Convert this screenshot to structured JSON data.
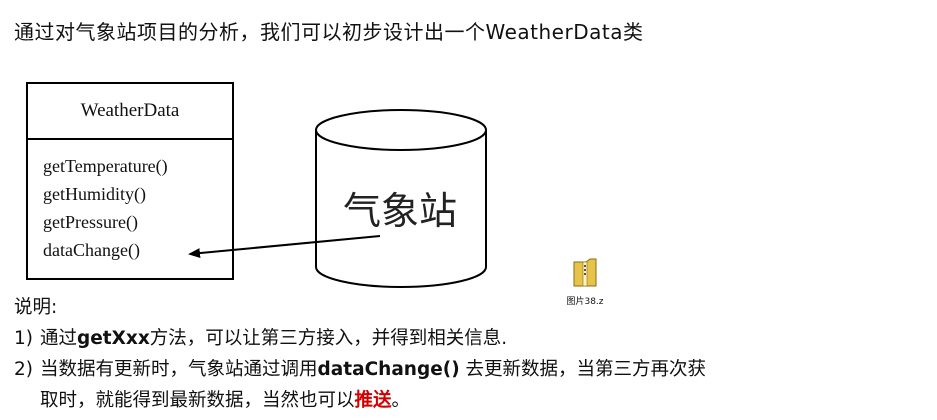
{
  "heading": "通过对气象站项目的分析，我们可以初步设计出一个WeatherData类",
  "uml": {
    "class_name": "WeatherData",
    "methods": [
      "getTemperature()",
      "getHumidity()",
      "getPressure()",
      "dataChange()"
    ]
  },
  "cylinder_label": "气象站",
  "file_icon": {
    "label": "图片38.z",
    "icon": "zip-archive-icon"
  },
  "notes": {
    "title": "说明:",
    "item1": {
      "num": "1)",
      "pre": "通过",
      "bold": "getXxx",
      "post": "方法，可以让第三方接入，并得到相关信息."
    },
    "item2": {
      "num": "2)",
      "pre": "当数据有更新时，气象站通过调用",
      "bold": "dataChange()",
      "post": " 去更新数据，当第三方再次获",
      "line2_pre": "取时，就能得到最新数据，当然也可以",
      "highlight": "推送",
      "line2_post": "。"
    }
  },
  "colors": {
    "highlight": "#d40000"
  }
}
